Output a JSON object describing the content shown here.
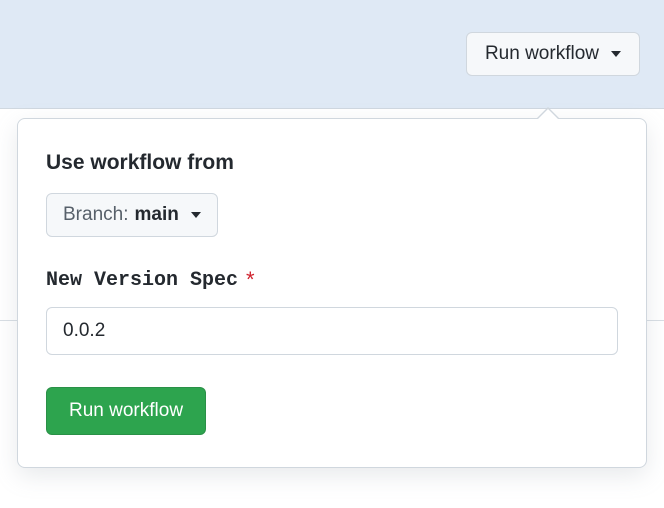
{
  "trigger": {
    "label": "Run workflow"
  },
  "popover": {
    "use_from_label": "Use workflow from",
    "branch": {
      "prefix": "Branch:",
      "name": "main"
    },
    "field": {
      "label": "New Version Spec",
      "required_mark": "*",
      "value": "0.0.2"
    },
    "submit_label": "Run workflow"
  }
}
